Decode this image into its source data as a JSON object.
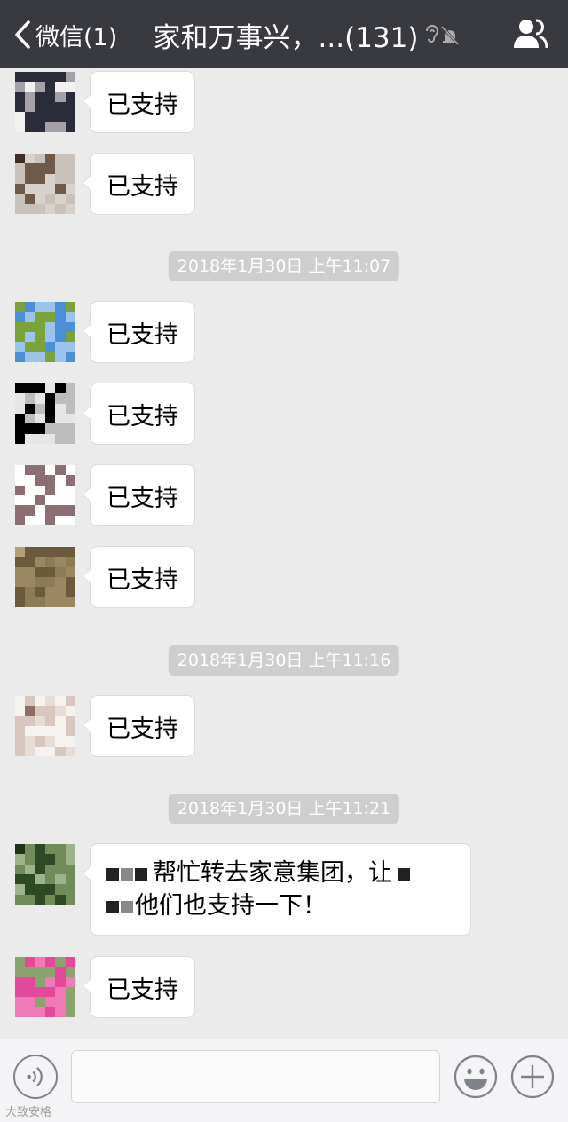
{
  "nav": {
    "back_label": "微信(1)",
    "title": "家和万事兴，...(131)",
    "icons": [
      "back-chevron-icon",
      "earpiece-icon",
      "mute-bell-icon",
      "group-members-icon"
    ]
  },
  "messages": [
    {
      "kind": "msg",
      "text": "已支持",
      "avatar": "avatar-1"
    },
    {
      "kind": "msg",
      "text": "已支持",
      "avatar": "avatar-2"
    },
    {
      "kind": "time",
      "text": "2018年1月30日 上午11:07"
    },
    {
      "kind": "msg",
      "text": "已支持",
      "avatar": "avatar-3"
    },
    {
      "kind": "msg",
      "text": "已支持",
      "avatar": "avatar-4"
    },
    {
      "kind": "msg",
      "text": "已支持",
      "avatar": "avatar-5"
    },
    {
      "kind": "msg",
      "text": "已支持",
      "avatar": "avatar-6"
    },
    {
      "kind": "time",
      "text": "2018年1月30日 上午11:16"
    },
    {
      "kind": "msg",
      "text": "已支持",
      "avatar": "avatar-7"
    },
    {
      "kind": "time",
      "text": "2018年1月30日 上午11:21"
    },
    {
      "kind": "msg",
      "avatar": "avatar-8",
      "line1": "帮忙转去家意集团，让",
      "line2": "他们也支持一下！"
    },
    {
      "kind": "msg",
      "text": "已支持",
      "avatar": "avatar-9"
    }
  ],
  "toolbar": {
    "voice_icon": "voice-input-icon",
    "input_value": "",
    "emoji_icon": "emoji-icon",
    "plus_icon": "plus-icon"
  },
  "watermark": "大致安格",
  "colors": {
    "nav_bg": "#393a3f",
    "chat_bg": "#ebebeb",
    "bubble_bg": "#ffffff",
    "timestamp_bg": "#cecece"
  }
}
